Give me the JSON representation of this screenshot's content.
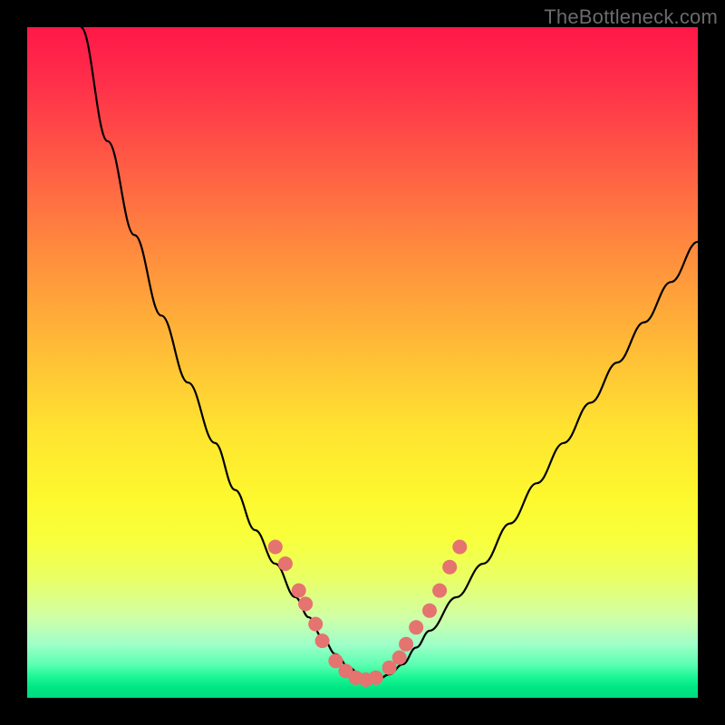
{
  "watermark": "TheBottleneck.com",
  "colors": {
    "curve_stroke": "#000000",
    "dot_fill": "#e5736f",
    "background": "#000000"
  },
  "chart_data": {
    "type": "line",
    "title": "",
    "xlabel": "",
    "ylabel": "",
    "xlim": [
      0,
      100
    ],
    "ylim": [
      0,
      100
    ],
    "grid": false,
    "legend": false,
    "note": "V-shaped bottleneck curve; values are approximate percentages read from image coordinates (y = percent from top, 0 at top, 100 at bottom/green).",
    "series": [
      {
        "name": "bottleneck-curve",
        "x": [
          8,
          12,
          16,
          20,
          24,
          28,
          31,
          34,
          37,
          40,
          42,
          44,
          46,
          48,
          50,
          52,
          54,
          56,
          58,
          60,
          64,
          68,
          72,
          76,
          80,
          84,
          88,
          92,
          96,
          100
        ],
        "y": [
          0,
          17,
          31,
          43,
          53,
          62,
          69,
          75,
          80,
          85,
          88,
          91,
          93.5,
          95.5,
          97,
          97.5,
          96.5,
          95,
          92.5,
          90,
          85,
          80,
          74,
          68,
          62,
          56,
          50,
          44,
          38,
          32
        ]
      }
    ],
    "highlight_dots": [
      {
        "x": 37.0,
        "y": 77.5
      },
      {
        "x": 38.5,
        "y": 80.0
      },
      {
        "x": 40.5,
        "y": 84.0
      },
      {
        "x": 41.5,
        "y": 86.0
      },
      {
        "x": 43.0,
        "y": 89.0
      },
      {
        "x": 44.0,
        "y": 91.5
      },
      {
        "x": 46.0,
        "y": 94.5
      },
      {
        "x": 47.5,
        "y": 96.0
      },
      {
        "x": 49.0,
        "y": 97.0
      },
      {
        "x": 50.5,
        "y": 97.3
      },
      {
        "x": 52.0,
        "y": 97.0
      },
      {
        "x": 54.0,
        "y": 95.5
      },
      {
        "x": 55.5,
        "y": 94.0
      },
      {
        "x": 56.5,
        "y": 92.0
      },
      {
        "x": 58.0,
        "y": 89.5
      },
      {
        "x": 60.0,
        "y": 87.0
      },
      {
        "x": 61.5,
        "y": 84.0
      },
      {
        "x": 63.0,
        "y": 80.5
      },
      {
        "x": 64.5,
        "y": 77.5
      }
    ]
  }
}
